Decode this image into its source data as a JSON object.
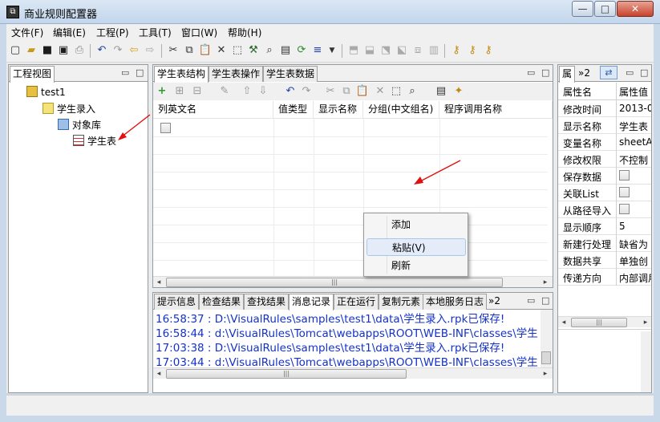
{
  "window": {
    "title": "商业规则配置器",
    "app_icon": "app-logo-icon",
    "min": "—",
    "max": "□",
    "close": "✕"
  },
  "menu": [
    "文件(F)",
    "编辑(E)",
    "工程(P)",
    "工具(T)",
    "窗口(W)",
    "帮助(H)"
  ],
  "toolbar_icons": [
    "new-icon",
    "open-icon",
    "save-icon",
    "save-all-icon",
    "print-icon",
    "undo-icon",
    "redo-icon",
    "back-icon",
    "forward-icon",
    "cut-icon",
    "copy-icon",
    "paste-icon",
    "delete-icon",
    "select-icon",
    "wand-icon",
    "find-icon",
    "properties-icon",
    "refresh-icon",
    "indent-icon",
    "dropdown-icon",
    "module-icon",
    "module2-icon",
    "export-icon",
    "import-icon",
    "copy2-icon",
    "library-icon",
    "run1-icon",
    "run2-icon",
    "run3-icon"
  ],
  "left_panel": {
    "tab": "工程视图",
    "tree": [
      {
        "label": "test1",
        "icon": "project-icon",
        "level": 0
      },
      {
        "label": "学生录入",
        "icon": "folder-icon",
        "level": 1
      },
      {
        "label": "对象库",
        "icon": "object-lib-icon",
        "level": 2
      },
      {
        "label": "学生表",
        "icon": "table-icon",
        "level": 3
      }
    ]
  },
  "center_panel": {
    "tabs": [
      "学生表结构",
      "学生表操作",
      "学生表数据"
    ],
    "columns": [
      "列英文名",
      "值类型",
      "显示名称",
      "分组(中文组名)",
      "程序调用名称"
    ],
    "context_menu": [
      "添加",
      "粘贴(V)",
      "刷新"
    ]
  },
  "right_panel": {
    "tabs": [
      "属",
      "»2"
    ],
    "headers": [
      "属性名",
      "属性值"
    ],
    "props": [
      {
        "name": "修改时间",
        "value": "2013-0"
      },
      {
        "name": "显示名称",
        "value": "学生表"
      },
      {
        "name": "变量名称",
        "value": "sheetA"
      },
      {
        "name": "修改权限",
        "value": "不控制"
      },
      {
        "name": "保存数据",
        "value": ""
      },
      {
        "name": "关联List",
        "value": ""
      },
      {
        "name": "从路径导入",
        "value": ""
      },
      {
        "name": "显示顺序",
        "value": "5"
      },
      {
        "name": "新建行处理",
        "value": "缺省为"
      },
      {
        "name": "数据共享",
        "value": "单独创"
      },
      {
        "name": "传递方向",
        "value": "内部调用"
      }
    ]
  },
  "bottom_panel": {
    "tabs": [
      "提示信息",
      "检查结果",
      "查找结果",
      "消息记录",
      "正在运行",
      "复制元素",
      "本地服务日志",
      "»2"
    ],
    "active_tab": "消息记录",
    "log": [
      "16:58:37 : D:\\VisualRules\\samples\\test1\\data\\学生录入.rpk已保存!",
      "16:58:44 : d:\\VisualRules\\Tomcat\\webapps\\ROOT\\WEB-INF\\classes\\学生",
      "17:03:38 : D:\\VisualRules\\samples\\test1\\data\\学生录入.rpk已保存!",
      "17:03:44 : d:\\VisualRules\\Tomcat\\webapps\\ROOT\\WEB-INF\\classes\\学生"
    ]
  },
  "colors": {
    "accent_red": "#e01010",
    "log_blue": "#1432c8"
  }
}
